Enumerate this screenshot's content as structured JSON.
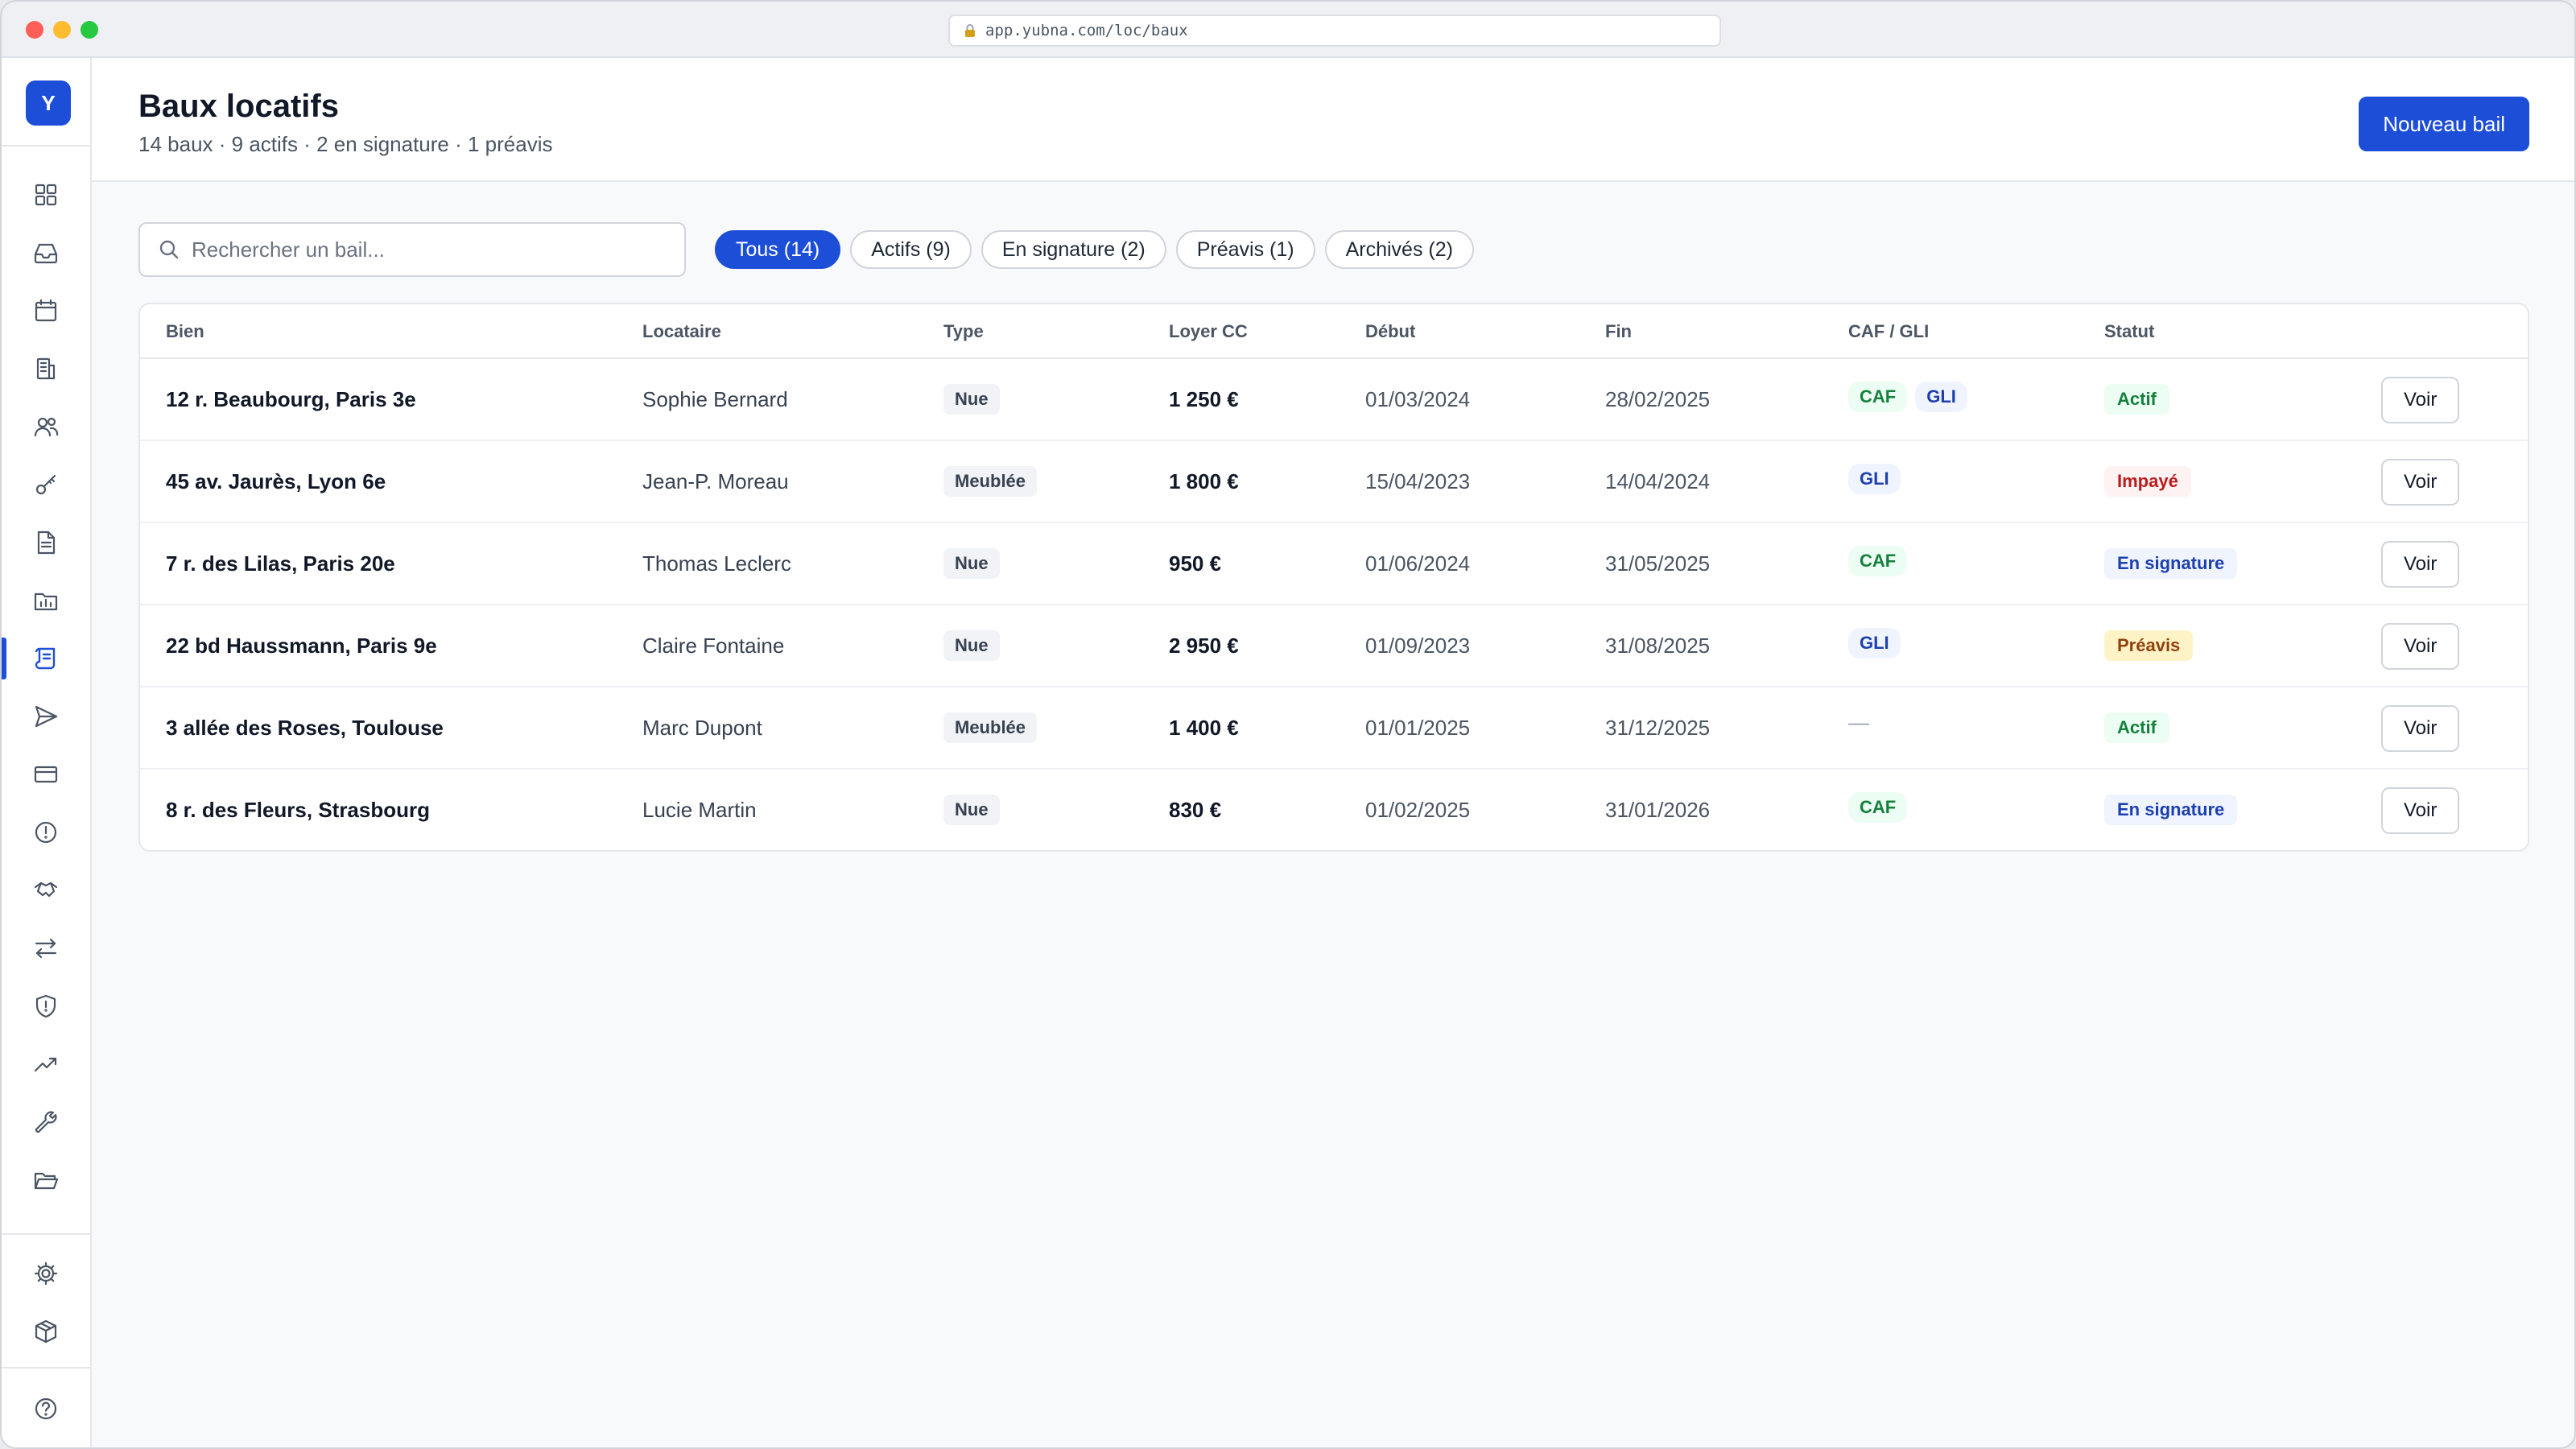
{
  "browser": {
    "url": "app.yubna.com/loc/baux"
  },
  "sidebar": {
    "logo_letter": "Y",
    "items": [
      {
        "icon": "dashboard-icon"
      },
      {
        "icon": "inbox-icon"
      },
      {
        "icon": "calendar-icon"
      },
      {
        "icon": "building-icon"
      },
      {
        "icon": "users-icon"
      },
      {
        "icon": "key-icon"
      },
      {
        "icon": "document-icon"
      },
      {
        "icon": "folder-chart-icon"
      },
      {
        "icon": "lease-scroll-icon",
        "active": true
      },
      {
        "icon": "send-icon"
      },
      {
        "icon": "credit-card-icon"
      },
      {
        "icon": "alert-circle-icon"
      },
      {
        "icon": "handshake-icon"
      },
      {
        "icon": "transfer-arrows-icon"
      },
      {
        "icon": "shield-icon"
      },
      {
        "icon": "trending-up-icon"
      },
      {
        "icon": "wrench-icon"
      },
      {
        "icon": "folder-open-icon"
      }
    ],
    "bottom_items": [
      {
        "icon": "gear-icon"
      },
      {
        "icon": "package-icon"
      },
      {
        "icon": "help-icon"
      }
    ]
  },
  "header": {
    "title": "Baux locatifs",
    "subtitle": "14 baux · 9 actifs · 2 en signature · 1 préavis",
    "primary_button": "Nouveau bail"
  },
  "search": {
    "placeholder": "Rechercher un bail..."
  },
  "filters": [
    {
      "label": "Tous (14)",
      "active": true
    },
    {
      "label": "Actifs (9)",
      "active": false
    },
    {
      "label": "En signature (2)",
      "active": false
    },
    {
      "label": "Préavis (1)",
      "active": false
    },
    {
      "label": "Archivés (2)",
      "active": false
    }
  ],
  "table": {
    "columns": [
      "Bien",
      "Locataire",
      "Type",
      "Loyer CC",
      "Début",
      "Fin",
      "CAF / GLI",
      "Statut"
    ],
    "action_label": "Voir",
    "rows": [
      {
        "bien": "12 r. Beaubourg, Paris 3e",
        "locataire": "Sophie Bernard",
        "type": "Nue",
        "loyer": "1 250 €",
        "debut": "01/03/2024",
        "fin": "28/02/2025",
        "tags": [
          "CAF",
          "GLI"
        ],
        "statut": "Actif",
        "statut_color": "#15803d"
      },
      {
        "bien": "45 av. Jaurès, Lyon 6e",
        "locataire": "Jean-P. Moreau",
        "type": "Meublée",
        "loyer": "1 800 €",
        "debut": "15/04/2023",
        "fin": "14/04/2024",
        "tags": [
          "GLI"
        ],
        "statut": "Impayé",
        "statut_color": "#b91c1c"
      },
      {
        "bien": "7 r. des Lilas, Paris 20e",
        "locataire": "Thomas Leclerc",
        "type": "Nue",
        "loyer": "950 €",
        "debut": "01/06/2024",
        "fin": "31/05/2025",
        "tags": [
          "CAF"
        ],
        "statut": "En signature",
        "statut_color": "#1e40af"
      },
      {
        "bien": "22 bd Haussmann, Paris 9e",
        "locataire": "Claire Fontaine",
        "type": "Nue",
        "loyer": "2 950 €",
        "debut": "01/09/2023",
        "fin": "31/08/2025",
        "tags": [
          "GLI"
        ],
        "statut": "Préavis",
        "statut_color": "#92400e"
      },
      {
        "bien": "3 allée des Roses, Toulouse",
        "locataire": "Marc Dupont",
        "type": "Meublée",
        "loyer": "1 400 €",
        "debut": "01/01/2025",
        "fin": "31/12/2025",
        "tags": [],
        "tags_empty": "—",
        "statut": "Actif",
        "statut_color": "#15803d"
      },
      {
        "bien": "8 r. des Fleurs, Strasbourg",
        "locataire": "Lucie Martin",
        "type": "Nue",
        "loyer": "830 €",
        "debut": "01/02/2025",
        "fin": "31/01/2026",
        "tags": [
          "CAF"
        ],
        "statut": "En signature",
        "statut_color": "#1e40af"
      }
    ]
  }
}
